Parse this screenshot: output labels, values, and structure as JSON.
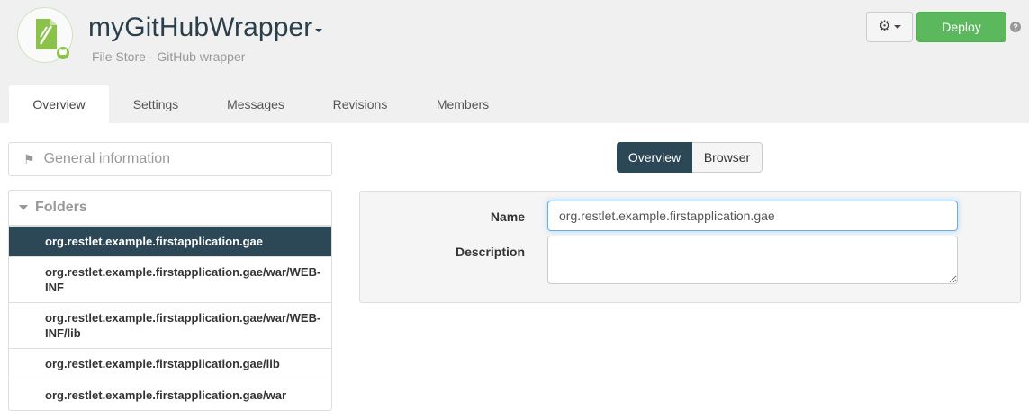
{
  "header": {
    "title": "myGitHubWrapper",
    "subtitle": "File Store - GitHub wrapper",
    "deploy_label": "Deploy",
    "help_label": "?",
    "settings_icon": "gear-icon",
    "accent_color": "#5cb85c"
  },
  "tabs": [
    {
      "label": "Overview",
      "active": true
    },
    {
      "label": "Settings",
      "active": false
    },
    {
      "label": "Messages",
      "active": false
    },
    {
      "label": "Revisions",
      "active": false
    },
    {
      "label": "Members",
      "active": false
    }
  ],
  "sidebar": {
    "general_info_label": "General information",
    "folders_label": "Folders",
    "folders": [
      {
        "label": "org.restlet.example.firstapplication.gae",
        "active": true
      },
      {
        "label": "org.restlet.example.firstapplication.gae/war/WEB-INF",
        "active": false
      },
      {
        "label": "org.restlet.example.firstapplication.gae/war/WEB-INF/lib",
        "active": false
      },
      {
        "label": "org.restlet.example.firstapplication.gae/lib",
        "active": false
      },
      {
        "label": "org.restlet.example.firstapplication.gae/war",
        "active": false
      }
    ],
    "active_color": "#2c4856"
  },
  "view_toggle": {
    "overview_label": "Overview",
    "browser_label": "Browser",
    "selected": "Overview"
  },
  "form": {
    "name_label": "Name",
    "name_value": "org.restlet.example.firstapplication.gae",
    "description_label": "Description",
    "description_value": ""
  }
}
